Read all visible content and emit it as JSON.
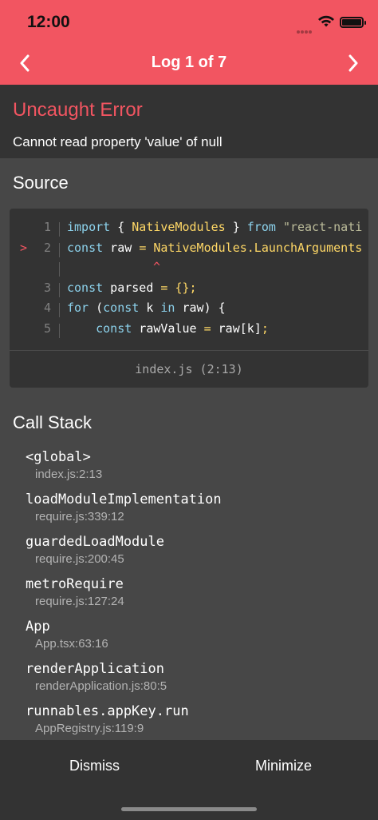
{
  "status_bar": {
    "time": "12:00"
  },
  "nav": {
    "title": "Log 1 of 7",
    "prev_icon": "chevron-left-icon",
    "next_icon": "chevron-right-icon"
  },
  "error": {
    "title": "Uncaught Error",
    "message": "Cannot read property 'value' of null"
  },
  "source": {
    "title": "Source",
    "lines": [
      {
        "marker": "",
        "num": "1",
        "tokens": [
          {
            "t": "import",
            "c": "kw"
          },
          {
            "t": " { ",
            "c": ""
          },
          {
            "t": "NativeModules",
            "c": "id"
          },
          {
            "t": " } ",
            "c": ""
          },
          {
            "t": "from",
            "c": "kw"
          },
          {
            "t": " ",
            "c": ""
          },
          {
            "t": "\"react-nati",
            "c": "st"
          }
        ]
      },
      {
        "marker": ">",
        "num": "2",
        "tokens": [
          {
            "t": "const",
            "c": "kw"
          },
          {
            "t": " raw ",
            "c": ""
          },
          {
            "t": "=",
            "c": "pu"
          },
          {
            "t": " ",
            "c": ""
          },
          {
            "t": "NativeModules.LaunchArguments",
            "c": "id"
          }
        ]
      },
      {
        "marker": "",
        "num": "",
        "caret": "^",
        "tokens": []
      },
      {
        "marker": "",
        "num": "3",
        "tokens": [
          {
            "t": "const",
            "c": "kw"
          },
          {
            "t": " parsed ",
            "c": ""
          },
          {
            "t": "= {};",
            "c": "pu"
          }
        ]
      },
      {
        "marker": "",
        "num": "4",
        "tokens": [
          {
            "t": "for",
            "c": "kw"
          },
          {
            "t": " (",
            "c": ""
          },
          {
            "t": "const",
            "c": "kw"
          },
          {
            "t": " k ",
            "c": ""
          },
          {
            "t": "in",
            "c": "kw"
          },
          {
            "t": " raw) {",
            "c": ""
          }
        ]
      },
      {
        "marker": "",
        "num": "5",
        "tokens": [
          {
            "t": "    ",
            "c": ""
          },
          {
            "t": "const",
            "c": "kw"
          },
          {
            "t": " rawValue ",
            "c": ""
          },
          {
            "t": "=",
            "c": "pu"
          },
          {
            "t": " raw[k]",
            "c": ""
          },
          {
            "t": ";",
            "c": "pu"
          }
        ]
      }
    ],
    "file": "index.js (2:13)"
  },
  "call_stack": {
    "title": "Call Stack",
    "frames": [
      {
        "name": "<global>",
        "location": "index.js:2:13"
      },
      {
        "name": "loadModuleImplementation",
        "location": "require.js:339:12"
      },
      {
        "name": "guardedLoadModule",
        "location": "require.js:200:45"
      },
      {
        "name": "metroRequire",
        "location": "require.js:127:24"
      },
      {
        "name": "App",
        "location": "App.tsx:63:16"
      },
      {
        "name": "renderApplication",
        "location": "renderApplication.js:80:5"
      },
      {
        "name": "runnables.appKey.run",
        "location": "AppRegistry.js:119:9"
      }
    ]
  },
  "footer": {
    "dismiss_label": "Dismiss",
    "minimize_label": "Minimize"
  }
}
